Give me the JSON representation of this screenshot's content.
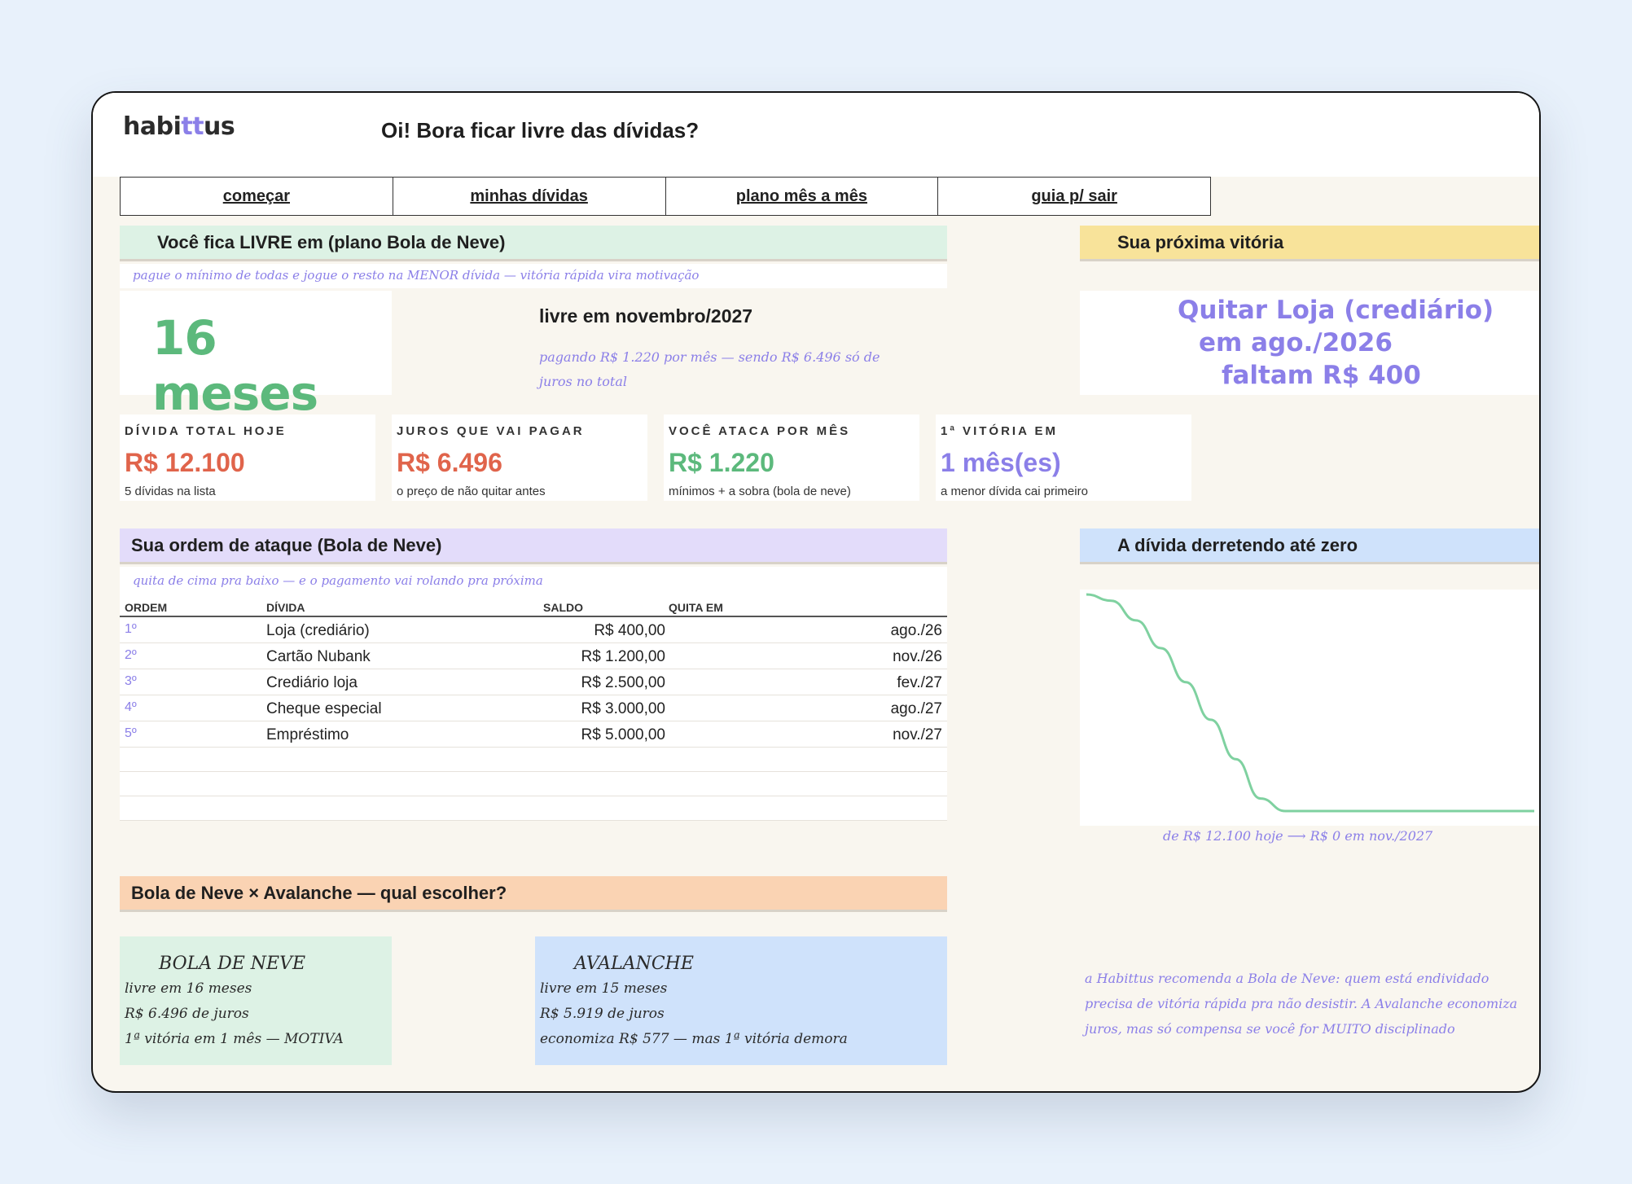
{
  "header": {
    "logo_pre": "habi",
    "logo_accent": "tt",
    "logo_post": "us",
    "greeting": "Oi! Bora ficar livre das dívidas?"
  },
  "tabs": [
    {
      "label": "começar"
    },
    {
      "label": "minhas dívidas"
    },
    {
      "label": "plano mês a mês"
    },
    {
      "label": "guia p/ sair"
    }
  ],
  "livre": {
    "section_title": "Você fica LIVRE em (plano Bola de Neve)",
    "hint": "pague o mínimo de todas e jogue o resto na MENOR dívida — vitória rápida vira motivação",
    "big": "16 meses",
    "date_line": "livre em novembro/2027",
    "detail": "pagando R$ 1.220 por mês — sendo R$ 6.496 só de juros no total"
  },
  "vitoria": {
    "section_title": "Sua próxima vitória",
    "line1": "Quitar Loja (crediário)",
    "line2": "em ago./2026",
    "line3": "faltam R$ 400"
  },
  "stats": [
    {
      "label": "DÍVIDA TOTAL HOJE",
      "value": "R$ 12.100",
      "sub": "5 dívidas na lista",
      "color": "#e0644b"
    },
    {
      "label": "JUROS QUE VAI PAGAR",
      "value": "R$ 6.496",
      "sub": "o preço de não quitar antes",
      "color": "#e0644b"
    },
    {
      "label": "VOCÊ ATACA POR MÊS",
      "value": "R$ 1.220",
      "sub": "mínimos + a sobra (bola de neve)",
      "color": "#5cb97c"
    },
    {
      "label": "1ª VITÓRIA EM",
      "value": "1 mês(es)",
      "sub": "a menor dívida cai primeiro",
      "color": "#8b7fe8"
    }
  ],
  "ordem": {
    "section_title": "Sua ordem de ataque (Bola de Neve)",
    "hint": "quita de cima pra baixo — e o pagamento vai rolando pra próxima",
    "headers": {
      "ordem": "ORDEM",
      "divida": "DÍVIDA",
      "saldo": "SALDO",
      "quita": "QUITA EM"
    },
    "rows": [
      {
        "ordem": "1º",
        "divida": "Loja (crediário)",
        "saldo": "R$ 400,00",
        "quita": "ago./26"
      },
      {
        "ordem": "2º",
        "divida": "Cartão Nubank",
        "saldo": "R$ 1.200,00",
        "quita": "nov./26"
      },
      {
        "ordem": "3º",
        "divida": "Crediário loja",
        "saldo": "R$ 2.500,00",
        "quita": "fev./27"
      },
      {
        "ordem": "4º",
        "divida": "Cheque especial",
        "saldo": "R$ 3.000,00",
        "quita": "ago./27"
      },
      {
        "ordem": "5º",
        "divida": "Empréstimo",
        "saldo": "R$ 5.000,00",
        "quita": "nov./27"
      }
    ]
  },
  "derretendo": {
    "section_title": "A dívida derretendo até zero",
    "caption": "de R$ 12.100 hoje ⟶ R$ 0 em nov./2027"
  },
  "chart_data": {
    "type": "line",
    "title": "",
    "xlabel": "",
    "ylabel": "",
    "x": [
      0,
      2,
      4,
      6,
      8,
      10,
      12,
      14,
      16,
      18,
      20,
      22,
      24,
      26,
      28,
      30,
      32,
      34,
      36
    ],
    "series": [
      {
        "values": [
          12100,
          11750,
          10650,
          9100,
          7200,
          5100,
          2900,
          700,
          0,
          0,
          0,
          0,
          0,
          0,
          0,
          0,
          0,
          0,
          0
        ],
        "color": "#7fd1a0"
      }
    ],
    "ylim": [
      0,
      12100
    ],
    "grid": false,
    "legend": "none"
  },
  "comparacao": {
    "section_title": "Bola de Neve × Avalanche — qual escolher?",
    "bola": {
      "title": "BOLA DE NEVE",
      "lines": [
        "livre em 16 meses",
        "R$ 6.496 de juros",
        "1ª vitória em 1 mês — MOTIVA"
      ]
    },
    "avalanche": {
      "title": "AVALANCHE",
      "lines": [
        "livre em 15 meses",
        "R$ 5.919 de juros",
        "economiza R$ 577 — mas 1ª vitória demora"
      ]
    },
    "recomendacao": "a Habittus recomenda a Bola de Neve: quem está endividado precisa de vitória rápida pra não desistir. A Avalanche economiza juros, mas só compensa se você for MUITO disciplinado"
  },
  "colors": {
    "green_bg": "#ddf2e5",
    "yellow_bg": "#f8e39a",
    "purple_bg": "#e3dcfa",
    "blue_bg": "#cfe2fb",
    "orange_bg": "#fad3b3",
    "accent_purple": "#8b7fe8",
    "green_big": "#5cb97c"
  }
}
